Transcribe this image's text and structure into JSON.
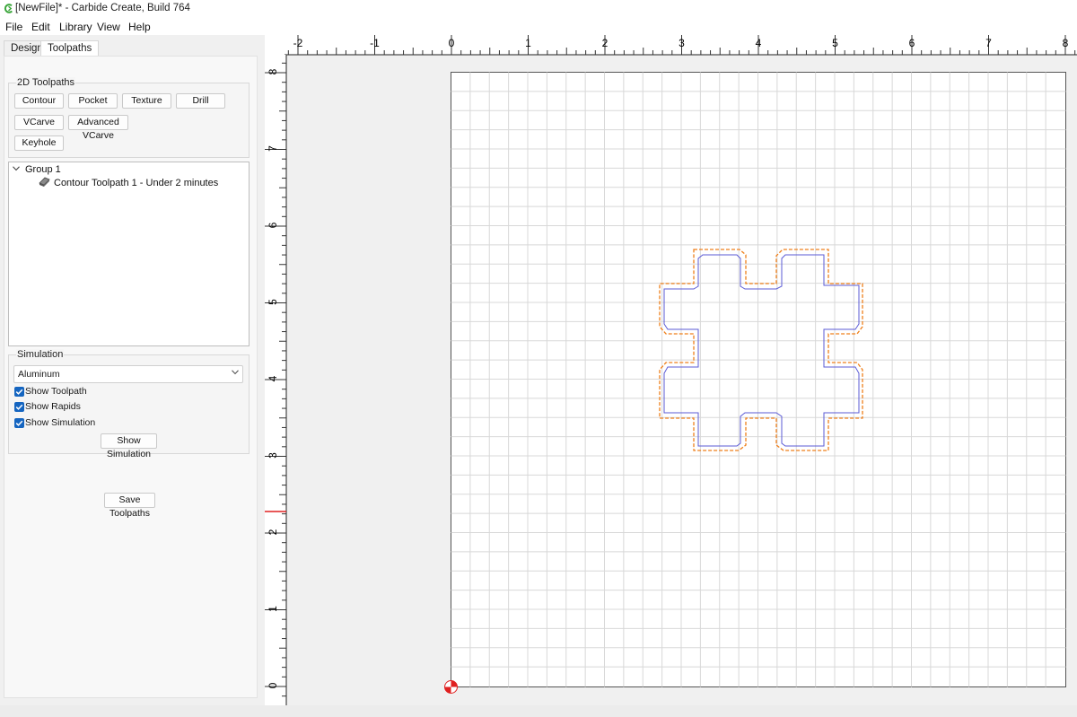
{
  "window": {
    "title": "[NewFile]* - Carbide Create, Build 764"
  },
  "menu": [
    "File",
    "Edit",
    "Library",
    "View",
    "Help"
  ],
  "tabs": {
    "design": "Design",
    "toolpaths": "Toolpaths"
  },
  "toolpaths_2d": {
    "title": "2D Toolpaths",
    "buttons": [
      "Contour",
      "Pocket",
      "Texture",
      "Drill",
      "VCarve",
      "Advanced VCarve",
      "Keyhole"
    ]
  },
  "tree": {
    "group": "Group 1",
    "item": "Contour Toolpath 1 - Under 2 minutes"
  },
  "simulation": {
    "title": "Simulation",
    "material": "Aluminum",
    "show_toolpath": {
      "label": "Show Toolpath",
      "checked": true
    },
    "show_rapids": {
      "label": "Show Rapids",
      "checked": true
    },
    "show_simulation": {
      "label": "Show Simulation",
      "checked": true
    },
    "button": "Show Simulation"
  },
  "save_button": "Save Toolpaths",
  "ruler": {
    "x_labels": [
      "-2",
      "-1",
      "0",
      "1",
      "2",
      "3",
      "4",
      "5",
      "6",
      "7",
      "8"
    ],
    "y_labels": [
      "8",
      "7",
      "6",
      "5",
      "4",
      "3",
      "2",
      "1",
      "0"
    ]
  },
  "colors": {
    "toolpath_outline": "#ef7f1a",
    "shape_outline": "#5b5bd6",
    "origin": "#e02020",
    "checkbox": "#1565c0",
    "app_icon": "#3aa53a"
  },
  "icons": {
    "app": "carbide-logo-icon",
    "tree_expand": "chevron-down-icon",
    "toolpath": "toolpath-icon",
    "select_arrow": "chevron-down-icon",
    "check": "checkmark-icon",
    "origin": "origin-marker-icon"
  }
}
